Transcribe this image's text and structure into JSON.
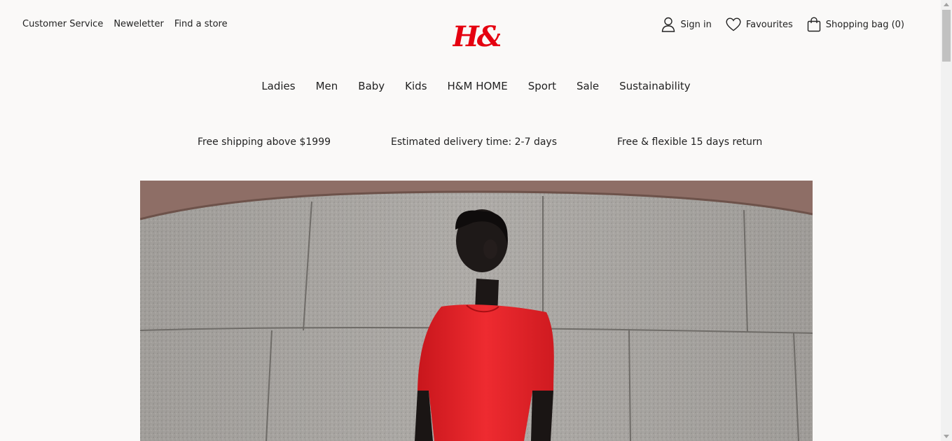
{
  "top_links": [
    "Customer Service",
    "Neweletter",
    "Find a store"
  ],
  "logo": {
    "text": "H&M",
    "color": "#e50010"
  },
  "account": {
    "sign_in": "Sign in",
    "favourites": "Favourites",
    "shopping_bag": "Shopping bag (0)",
    "icons": [
      "user-icon",
      "heart-icon",
      "bag-icon"
    ]
  },
  "nav": [
    "Ladies",
    "Men",
    "Baby",
    "Kids",
    "H&M HOME",
    "Sport",
    "Sale",
    "Sustainability"
  ],
  "promo": [
    "Free shipping above $1999",
    "Estimated delivery time: 2-7 days",
    "Free & flexible 15 days return"
  ],
  "hero": {
    "dress_color": "#e8262d"
  }
}
